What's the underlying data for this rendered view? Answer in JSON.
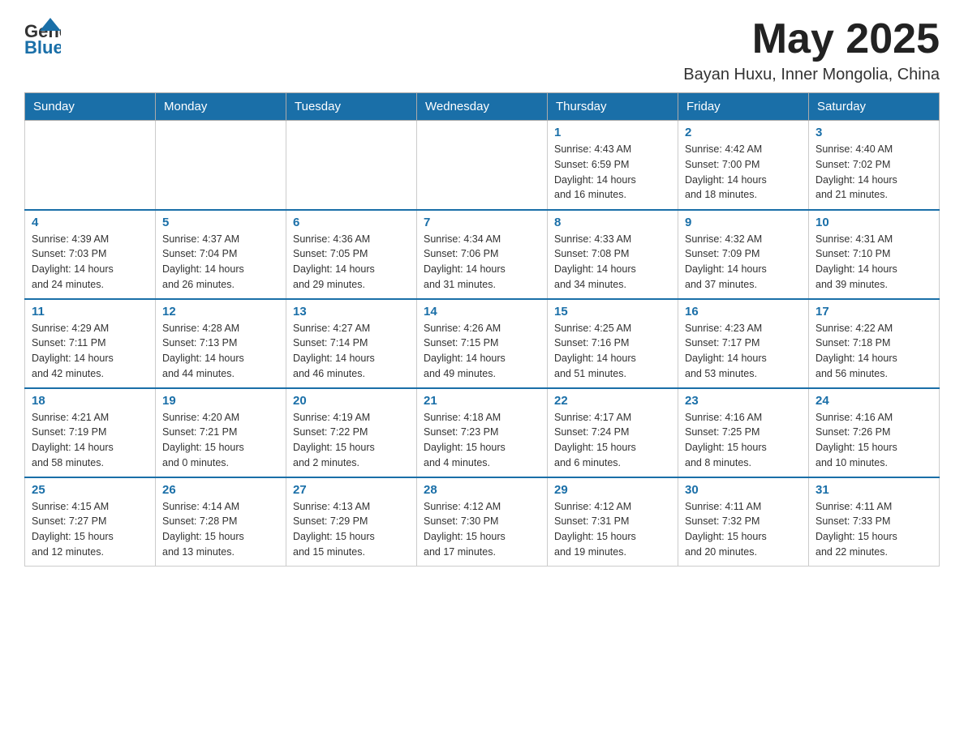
{
  "header": {
    "logo_general": "General",
    "logo_blue": "Blue",
    "month_year": "May 2025",
    "location": "Bayan Huxu, Inner Mongolia, China"
  },
  "days_of_week": [
    "Sunday",
    "Monday",
    "Tuesday",
    "Wednesday",
    "Thursday",
    "Friday",
    "Saturday"
  ],
  "weeks": [
    {
      "days": [
        {
          "number": "",
          "info": ""
        },
        {
          "number": "",
          "info": ""
        },
        {
          "number": "",
          "info": ""
        },
        {
          "number": "",
          "info": ""
        },
        {
          "number": "1",
          "info": "Sunrise: 4:43 AM\nSunset: 6:59 PM\nDaylight: 14 hours\nand 16 minutes."
        },
        {
          "number": "2",
          "info": "Sunrise: 4:42 AM\nSunset: 7:00 PM\nDaylight: 14 hours\nand 18 minutes."
        },
        {
          "number": "3",
          "info": "Sunrise: 4:40 AM\nSunset: 7:02 PM\nDaylight: 14 hours\nand 21 minutes."
        }
      ]
    },
    {
      "days": [
        {
          "number": "4",
          "info": "Sunrise: 4:39 AM\nSunset: 7:03 PM\nDaylight: 14 hours\nand 24 minutes."
        },
        {
          "number": "5",
          "info": "Sunrise: 4:37 AM\nSunset: 7:04 PM\nDaylight: 14 hours\nand 26 minutes."
        },
        {
          "number": "6",
          "info": "Sunrise: 4:36 AM\nSunset: 7:05 PM\nDaylight: 14 hours\nand 29 minutes."
        },
        {
          "number": "7",
          "info": "Sunrise: 4:34 AM\nSunset: 7:06 PM\nDaylight: 14 hours\nand 31 minutes."
        },
        {
          "number": "8",
          "info": "Sunrise: 4:33 AM\nSunset: 7:08 PM\nDaylight: 14 hours\nand 34 minutes."
        },
        {
          "number": "9",
          "info": "Sunrise: 4:32 AM\nSunset: 7:09 PM\nDaylight: 14 hours\nand 37 minutes."
        },
        {
          "number": "10",
          "info": "Sunrise: 4:31 AM\nSunset: 7:10 PM\nDaylight: 14 hours\nand 39 minutes."
        }
      ]
    },
    {
      "days": [
        {
          "number": "11",
          "info": "Sunrise: 4:29 AM\nSunset: 7:11 PM\nDaylight: 14 hours\nand 42 minutes."
        },
        {
          "number": "12",
          "info": "Sunrise: 4:28 AM\nSunset: 7:13 PM\nDaylight: 14 hours\nand 44 minutes."
        },
        {
          "number": "13",
          "info": "Sunrise: 4:27 AM\nSunset: 7:14 PM\nDaylight: 14 hours\nand 46 minutes."
        },
        {
          "number": "14",
          "info": "Sunrise: 4:26 AM\nSunset: 7:15 PM\nDaylight: 14 hours\nand 49 minutes."
        },
        {
          "number": "15",
          "info": "Sunrise: 4:25 AM\nSunset: 7:16 PM\nDaylight: 14 hours\nand 51 minutes."
        },
        {
          "number": "16",
          "info": "Sunrise: 4:23 AM\nSunset: 7:17 PM\nDaylight: 14 hours\nand 53 minutes."
        },
        {
          "number": "17",
          "info": "Sunrise: 4:22 AM\nSunset: 7:18 PM\nDaylight: 14 hours\nand 56 minutes."
        }
      ]
    },
    {
      "days": [
        {
          "number": "18",
          "info": "Sunrise: 4:21 AM\nSunset: 7:19 PM\nDaylight: 14 hours\nand 58 minutes."
        },
        {
          "number": "19",
          "info": "Sunrise: 4:20 AM\nSunset: 7:21 PM\nDaylight: 15 hours\nand 0 minutes."
        },
        {
          "number": "20",
          "info": "Sunrise: 4:19 AM\nSunset: 7:22 PM\nDaylight: 15 hours\nand 2 minutes."
        },
        {
          "number": "21",
          "info": "Sunrise: 4:18 AM\nSunset: 7:23 PM\nDaylight: 15 hours\nand 4 minutes."
        },
        {
          "number": "22",
          "info": "Sunrise: 4:17 AM\nSunset: 7:24 PM\nDaylight: 15 hours\nand 6 minutes."
        },
        {
          "number": "23",
          "info": "Sunrise: 4:16 AM\nSunset: 7:25 PM\nDaylight: 15 hours\nand 8 minutes."
        },
        {
          "number": "24",
          "info": "Sunrise: 4:16 AM\nSunset: 7:26 PM\nDaylight: 15 hours\nand 10 minutes."
        }
      ]
    },
    {
      "days": [
        {
          "number": "25",
          "info": "Sunrise: 4:15 AM\nSunset: 7:27 PM\nDaylight: 15 hours\nand 12 minutes."
        },
        {
          "number": "26",
          "info": "Sunrise: 4:14 AM\nSunset: 7:28 PM\nDaylight: 15 hours\nand 13 minutes."
        },
        {
          "number": "27",
          "info": "Sunrise: 4:13 AM\nSunset: 7:29 PM\nDaylight: 15 hours\nand 15 minutes."
        },
        {
          "number": "28",
          "info": "Sunrise: 4:12 AM\nSunset: 7:30 PM\nDaylight: 15 hours\nand 17 minutes."
        },
        {
          "number": "29",
          "info": "Sunrise: 4:12 AM\nSunset: 7:31 PM\nDaylight: 15 hours\nand 19 minutes."
        },
        {
          "number": "30",
          "info": "Sunrise: 4:11 AM\nSunset: 7:32 PM\nDaylight: 15 hours\nand 20 minutes."
        },
        {
          "number": "31",
          "info": "Sunrise: 4:11 AM\nSunset: 7:33 PM\nDaylight: 15 hours\nand 22 minutes."
        }
      ]
    }
  ]
}
